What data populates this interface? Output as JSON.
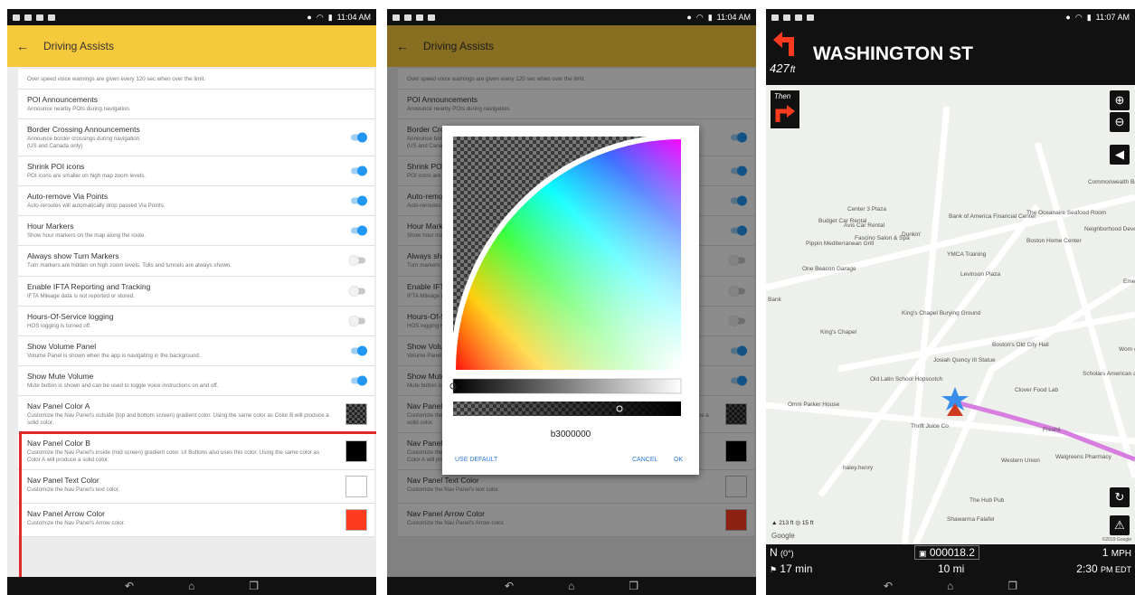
{
  "status": {
    "time1": "11:04 AM",
    "time2": "11:04 AM",
    "time3": "11:07 AM"
  },
  "appbar": {
    "title": "Driving Assists",
    "back": "←"
  },
  "settings": [
    {
      "title": "",
      "sub": "Over speed voice warnings are given every 120 sec when over the limit.",
      "ctl": "none"
    },
    {
      "title": "POI Announcements",
      "sub": "Announce nearby POIs during navigation.",
      "ctl": "none"
    },
    {
      "title": "Border Crossing Announcements",
      "sub": "Announce border crossings during navigation.\n(US and Canada only)",
      "ctl": "on"
    },
    {
      "title": "Shrink POI icons",
      "sub": "POI icons are smaller on high map zoom levels.",
      "ctl": "on"
    },
    {
      "title": "Auto-remove Via Points",
      "sub": "Auto-reroutes will automatically drop passed Via Points.",
      "ctl": "on"
    },
    {
      "title": "Hour Markers",
      "sub": "Show hour markers on the map along the route.",
      "ctl": "on"
    },
    {
      "title": "Always show Turn Markers",
      "sub": "Turn markers are hidden on high zoom levels. Tolls and tunnels are always shown.",
      "ctl": "off"
    },
    {
      "title": "Enable IFTA Reporting and Tracking",
      "sub": "IFTA Mileage data is not reported or stored.",
      "ctl": "off"
    },
    {
      "title": "Hours-Of-Service logging",
      "sub": "HOS logging is turned off.",
      "ctl": "off"
    },
    {
      "title": "Show Volume Panel",
      "sub": "Volume Panel is shown when the app is navigating in the background.",
      "ctl": "on"
    },
    {
      "title": "Show Mute Volume",
      "sub": "Mute button is shown and can be used to toggle voice instructions on and off.",
      "ctl": "on"
    },
    {
      "title": "Nav Panel Color A",
      "sub": "Customize the Nav Panel's outside (top and bottom screen) gradient color. Using the same color as Color B will produce a solid color.",
      "ctl": "checker"
    },
    {
      "title": "Nav Panel Color B",
      "sub": "Customize the Nav Panel's inside (mid screen) gradient color. UI Buttons also uses this color. Using the same color as Color A will produce a solid color.",
      "ctl": "#000000"
    },
    {
      "title": "Nav Panel Text Color",
      "sub": "Customize the Nav Panel's text color.",
      "ctl": "#ffffff"
    },
    {
      "title": "Nav Panel Arrow Color",
      "sub": "Customize the Nav Panel's Arrow color.",
      "ctl": "#ff3b1f"
    }
  ],
  "dialog": {
    "hex_value": "b3000000",
    "use_default": "USE DEFAULT",
    "cancel": "CANCEL",
    "ok": "OK"
  },
  "nav": {
    "distance": "427",
    "distance_unit": "ft",
    "street": "WASHINGTON ST",
    "then": "Then",
    "heading": "N",
    "heading_deg": "(0°)",
    "odometer": "000018.2",
    "speed": "1",
    "speed_unit": "MPH",
    "eta_time": "17 min",
    "remaining_dist": "10 mi",
    "arrival_time": "2:30",
    "arrival_ampm": "PM EDT",
    "scale_alt": "213 ft",
    "scale_gps": "15 ft",
    "google": "Google",
    "copyright": "©2019 Google"
  },
  "map_labels": [
    "Center 3 Plaza",
    "Budget Car Rental",
    "Bank of America Financial Center",
    "The Oceanaire Seafood Room",
    "Commonwealth Bank",
    "Avis Car Rental",
    "Dunkin'",
    "Neighborhood Development",
    "Pippin Mediterranean Grill",
    "Fascino Salon & Spa",
    "YMCA Training",
    "Boston Home Center",
    "One Beacon Garage",
    "Levinson Plaza",
    "King's Chapel Burying Ground",
    "King's Chapel",
    "Boston's Old City Hall",
    "Josiah Quincy III Statue",
    "Old Latin School Hopscotch",
    "Clover Food Lab",
    "Scholars American and Cocktail Lou",
    "Omni Parker House",
    "Thrift Juice Co",
    "Freshii",
    "Western Union",
    "Walgreens Pharmacy",
    "haley.henry",
    "The Hub Pub",
    "Shawarma Falafel",
    "Emerg",
    "Wom of Bo",
    "Bank"
  ]
}
